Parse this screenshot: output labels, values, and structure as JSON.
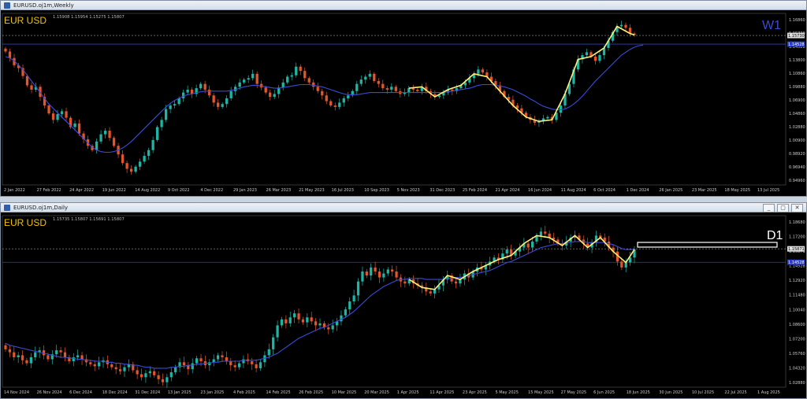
{
  "colors": {
    "bull": "#1fb5a5",
    "bear": "#e2562a",
    "ma": "#3b4bd6",
    "zigzag": "#fff07a",
    "hline": "#1e2a7a",
    "grid": "#9a9a9a",
    "axisText": "#cccccc",
    "symbol": "#f2c200",
    "tf_w1": "#3b4bd6",
    "tf_d1": "#ffffff"
  },
  "windows": [
    {
      "title": "EURUSD.oj1m,Weekly",
      "ohlc": "1.15908 1.15954 1.15275 1.15807",
      "symbol": "EUR USD",
      "timeframe": "W1",
      "price_labels": [
        "1.16860",
        "1.15730",
        "1.14528",
        "1.13800",
        "1.10860",
        "1.09880",
        "1.06900",
        "1.04860",
        "1.02880",
        "1.00900",
        "0.98920",
        "0.96940",
        "0.94960"
      ],
      "current_price": "1.15730",
      "level_price": "1.14528",
      "date_labels": [
        "2 Jan 2022",
        "27 Feb 2022",
        "24 Apr 2022",
        "19 Jun 2022",
        "14 Aug 2022",
        "9 Oct 2022",
        "4 Dec 2022",
        "29 Jan 2023",
        "26 Mar 2023",
        "21 May 2023",
        "16 Jul 2023",
        "10 Sep 2023",
        "5 Nov 2023",
        "31 Dec 2023",
        "25 Feb 2024",
        "21 Apr 2024",
        "16 Jun 2024",
        "11 Aug 2024",
        "6 Oct 2024",
        "1 Dec 2024",
        "26 Jan 2025",
        "23 Mar 2025",
        "18 May 2025",
        "13 Jul 2025"
      ],
      "buttons": []
    },
    {
      "title": "EURUSD.oj1m,Daily",
      "ohlc": "1.15735 1.15807 1.15691 1.15807",
      "symbol": "EUR USD",
      "timeframe": "D1",
      "price_labels": [
        "1.18680",
        "1.17200",
        "1.15871",
        "1.14528",
        "1.12920",
        "1.11480",
        "1.10040",
        "1.08600",
        "1.07200",
        "1.05760",
        "1.04320",
        "1.02880"
      ],
      "current_price": "1.15871",
      "level_price": "1.14528",
      "date_labels": [
        "14 Nov 2024",
        "26 Nov 2024",
        "6 Dec 2024",
        "18 Dec 2024",
        "31 Dec 2024",
        "13 Jan 2025",
        "23 Jan 2025",
        "4 Feb 2025",
        "14 Feb 2025",
        "26 Feb 2025",
        "10 Mar 2025",
        "20 Mar 2025",
        "1 Apr 2025",
        "11 Apr 2025",
        "23 Apr 2025",
        "5 May 2025",
        "15 May 2025",
        "27 May 2025",
        "6 Jun 2025",
        "18 Jun 2025",
        "30 Jun 2025",
        "10 Jul 2025",
        "22 Jul 2025",
        "1 Aug 2025"
      ],
      "buttons": [
        "_",
        "▢",
        "✕"
      ]
    }
  ],
  "chart_data": [
    {
      "type": "candlestick",
      "title": "EUR USD W1",
      "ylim": [
        0.9496,
        1.188
      ],
      "series": [
        {
          "name": "price",
          "close": [
            1.135,
            1.126,
            1.116,
            1.112,
            1.101,
            1.088,
            1.082,
            1.086,
            1.072,
            1.06,
            1.049,
            1.04,
            1.048,
            1.052,
            1.043,
            1.03,
            1.035,
            1.021,
            1.013,
            1.004,
            0.998,
            1.01,
            1.02,
            1.025,
            1.015,
            1.004,
            0.992,
            0.98,
            0.972,
            0.968,
            0.975,
            0.982,
            0.99,
            0.998,
            1.012,
            1.03,
            1.04,
            1.055,
            1.06,
            1.062,
            1.07,
            1.078,
            1.082,
            1.076,
            1.084,
            1.09,
            1.082,
            1.074,
            1.064,
            1.058,
            1.062,
            1.07,
            1.08,
            1.086,
            1.092,
            1.096,
            1.098,
            1.104,
            1.09,
            1.085,
            1.078,
            1.072,
            1.076,
            1.085,
            1.092,
            1.1,
            1.102,
            1.114,
            1.108,
            1.098,
            1.092,
            1.086,
            1.08,
            1.074,
            1.066,
            1.06,
            1.058,
            1.064,
            1.07,
            1.074,
            1.08,
            1.09,
            1.096,
            1.1,
            1.104,
            1.094,
            1.09,
            1.084,
            1.082,
            1.086,
            1.08,
            1.076,
            1.078,
            1.084,
            1.082,
            1.08,
            1.086,
            1.08,
            1.076,
            1.072,
            1.074,
            1.078,
            1.082,
            1.08,
            1.084,
            1.088,
            1.092,
            1.098,
            1.104,
            1.11,
            1.106,
            1.1,
            1.094,
            1.088,
            1.08,
            1.072,
            1.068,
            1.06,
            1.056,
            1.05,
            1.044,
            1.04,
            1.036,
            1.038,
            1.042,
            1.044,
            1.04,
            1.05,
            1.06,
            1.076,
            1.09,
            1.11,
            1.124,
            1.13,
            1.134,
            1.128,
            1.122,
            1.13,
            1.14,
            1.15,
            1.162,
            1.17,
            1.172,
            1.168,
            1.16,
            1.158
          ]
        },
        {
          "name": "MA",
          "values": [
            1.128,
            1.126,
            1.122,
            1.116,
            1.11,
            1.102,
            1.094,
            1.086,
            1.078,
            1.07,
            1.062,
            1.056,
            1.05,
            1.044,
            1.038,
            1.032,
            1.026,
            1.02,
            1.014,
            1.008,
            1.002,
            0.998,
            0.996,
            0.995,
            0.995,
            0.996,
            0.998,
            1.001,
            1.005,
            1.01,
            1.016,
            1.022,
            1.028,
            1.034,
            1.04,
            1.046,
            1.052,
            1.058,
            1.063,
            1.067,
            1.07,
            1.073,
            1.075,
            1.076,
            1.078,
            1.079,
            1.08,
            1.08,
            1.08,
            1.08,
            1.08,
            1.08,
            1.081,
            1.082,
            1.084,
            1.086,
            1.087,
            1.088,
            1.088,
            1.087,
            1.086,
            1.085,
            1.084,
            1.084,
            1.085,
            1.086,
            1.087,
            1.088,
            1.089,
            1.089,
            1.089,
            1.088,
            1.087,
            1.086,
            1.084,
            1.082,
            1.08,
            1.078,
            1.076,
            1.075,
            1.075,
            1.075,
            1.076,
            1.077,
            1.078,
            1.078,
            1.078,
            1.078,
            1.078,
            1.078,
            1.078,
            1.078,
            1.078,
            1.078,
            1.078,
            1.078,
            1.078,
            1.078,
            1.078,
            1.078,
            1.078,
            1.078,
            1.079,
            1.08,
            1.081,
            1.082,
            1.083,
            1.084,
            1.086,
            1.088,
            1.089,
            1.089,
            1.089,
            1.088,
            1.087,
            1.086,
            1.084,
            1.082,
            1.079,
            1.076,
            1.073,
            1.069,
            1.066,
            1.062,
            1.059,
            1.057,
            1.055,
            1.054,
            1.054,
            1.055,
            1.058,
            1.062,
            1.067,
            1.073,
            1.08,
            1.087,
            1.094,
            1.1,
            1.106,
            1.112,
            1.118,
            1.124,
            1.13,
            1.134,
            1.138,
            1.141,
            1.143,
            1.144
          ]
        }
      ]
    },
    {
      "type": "candlestick",
      "title": "EUR USD D1",
      "ylim": [
        1.02,
        1.192
      ],
      "series": [
        {
          "name": "price",
          "close": [
            1.058,
            1.055,
            1.05,
            1.052,
            1.047,
            1.044,
            1.05,
            1.055,
            1.057,
            1.052,
            1.048,
            1.053,
            1.057,
            1.055,
            1.05,
            1.046,
            1.05,
            1.052,
            1.048,
            1.045,
            1.043,
            1.041,
            1.045,
            1.047,
            1.043,
            1.04,
            1.038,
            1.036,
            1.04,
            1.043,
            1.037,
            1.033,
            1.03,
            1.034,
            1.036,
            1.032,
            1.028,
            1.025,
            1.03,
            1.035,
            1.04,
            1.045,
            1.042,
            1.038,
            1.044,
            1.049,
            1.046,
            1.042,
            1.045,
            1.048,
            1.052,
            1.05,
            1.046,
            1.042,
            1.04,
            1.044,
            1.048,
            1.046,
            1.043,
            1.039,
            1.045,
            1.052,
            1.058,
            1.07,
            1.082,
            1.088,
            1.084,
            1.09,
            1.094,
            1.088,
            1.085,
            1.09,
            1.086,
            1.082,
            1.084,
            1.08,
            1.078,
            1.082,
            1.086,
            1.092,
            1.098,
            1.106,
            1.112,
            1.126,
            1.136,
            1.132,
            1.14,
            1.136,
            1.13,
            1.134,
            1.138,
            1.136,
            1.13,
            1.126,
            1.124,
            1.128,
            1.124,
            1.122,
            1.12,
            1.116,
            1.114,
            1.118,
            1.122,
            1.128,
            1.132,
            1.126,
            1.124,
            1.128,
            1.134,
            1.13,
            1.136,
            1.14,
            1.138,
            1.142,
            1.146,
            1.15,
            1.148,
            1.154,
            1.158,
            1.152,
            1.156,
            1.16,
            1.164,
            1.16,
            1.166,
            1.172,
            1.176,
            1.174,
            1.17,
            1.168,
            1.164,
            1.162,
            1.166,
            1.17,
            1.172,
            1.168,
            1.164,
            1.16,
            1.165,
            1.172,
            1.17,
            1.166,
            1.16,
            1.156,
            1.146,
            1.14,
            1.145,
            1.15,
            1.158
          ]
        },
        {
          "name": "MA",
          "values": [
            1.064,
            1.062,
            1.061,
            1.06,
            1.059,
            1.058,
            1.057,
            1.056,
            1.055,
            1.054,
            1.053,
            1.052,
            1.051,
            1.05,
            1.05,
            1.049,
            1.049,
            1.048,
            1.048,
            1.047,
            1.047,
            1.046,
            1.046,
            1.046,
            1.045,
            1.045,
            1.044,
            1.044,
            1.043,
            1.043,
            1.042,
            1.042,
            1.041,
            1.04,
            1.04,
            1.039,
            1.039,
            1.039,
            1.039,
            1.04,
            1.04,
            1.041,
            1.041,
            1.042,
            1.042,
            1.043,
            1.043,
            1.044,
            1.044,
            1.045,
            1.045,
            1.046,
            1.046,
            1.046,
            1.046,
            1.046,
            1.047,
            1.047,
            1.047,
            1.047,
            1.048,
            1.049,
            1.05,
            1.052,
            1.054,
            1.057,
            1.06,
            1.063,
            1.066,
            1.069,
            1.071,
            1.073,
            1.075,
            1.077,
            1.079,
            1.08,
            1.082,
            1.084,
            1.086,
            1.088,
            1.09,
            1.093,
            1.096,
            1.1,
            1.104,
            1.108,
            1.112,
            1.115,
            1.118,
            1.121,
            1.123,
            1.125,
            1.127,
            1.128,
            1.128,
            1.129,
            1.129,
            1.129,
            1.129,
            1.128,
            1.128,
            1.128,
            1.128,
            1.128,
            1.129,
            1.129,
            1.13,
            1.13,
            1.131,
            1.132,
            1.133,
            1.134,
            1.135,
            1.136,
            1.137,
            1.139,
            1.141,
            1.143,
            1.145,
            1.146,
            1.148,
            1.15,
            1.152,
            1.154,
            1.156,
            1.158,
            1.16,
            1.161,
            1.162,
            1.163,
            1.164,
            1.164,
            1.165,
            1.165,
            1.166,
            1.166,
            1.166,
            1.165,
            1.165,
            1.165,
            1.165,
            1.165,
            1.164,
            1.163,
            1.161,
            1.159,
            1.158,
            1.158,
            1.158
          ]
        }
      ]
    }
  ]
}
